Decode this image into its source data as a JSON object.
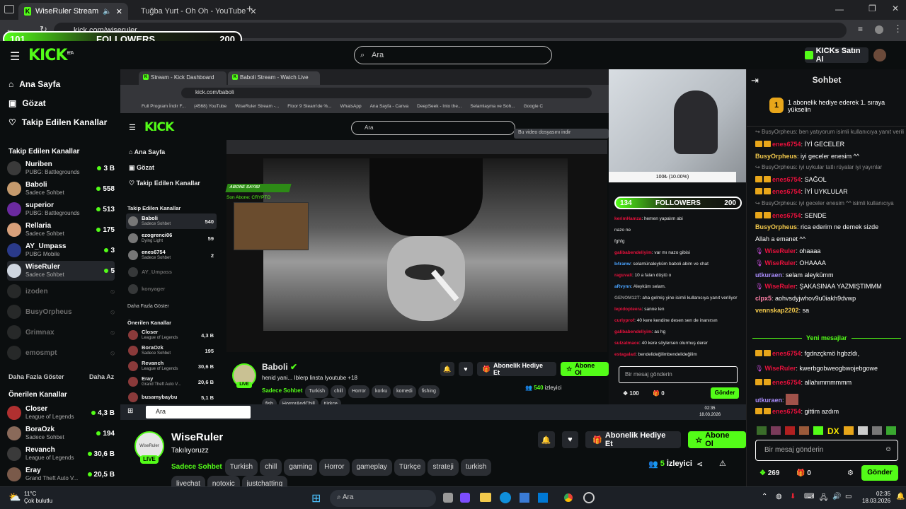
{
  "browser": {
    "tabs": [
      {
        "label": "WiseRuler Stream - Watch L",
        "active": true
      },
      {
        "label": "Tuğba Yurt - Oh Oh - YouTube",
        "active": false
      }
    ],
    "url": "kick.com/wiseruler"
  },
  "followers_overlay": {
    "current": "101",
    "label": "FOLLOWERS",
    "goal": "200"
  },
  "header": {
    "logo": "KICK",
    "logo_sup": "BETA",
    "search_placeholder": "Ara",
    "buy_kicks": "KICKs Satın Al"
  },
  "sidebar": {
    "nav": [
      {
        "label": "Ana Sayfa",
        "icon": "home-icon"
      },
      {
        "label": "Gözat",
        "icon": "browse-icon"
      },
      {
        "label": "Takip Edilen Kanallar",
        "icon": "heart-icon"
      }
    ],
    "followed_title": "Takip Edilen Kanallar",
    "followed": [
      {
        "name": "Nuriben",
        "category": "PUBG: Battlegrounds",
        "viewers": "3 B",
        "live": true
      },
      {
        "name": "Baboli",
        "category": "Sadece Sohbet",
        "viewers": "558",
        "live": true
      },
      {
        "name": "superior",
        "category": "PUBG: Battlegrounds",
        "viewers": "513",
        "live": true
      },
      {
        "name": "Rellaria",
        "category": "Sadece Sohbet",
        "viewers": "175",
        "live": true
      },
      {
        "name": "AY_Umpass",
        "category": "PUBG Mobile",
        "viewers": "3",
        "live": true
      },
      {
        "name": "WiseRuler",
        "category": "Sadece Sohbet",
        "viewers": "5",
        "live": true
      },
      {
        "name": "izoden",
        "category": "",
        "viewers": "",
        "live": false
      },
      {
        "name": "BusyOrpheus",
        "category": "",
        "viewers": "",
        "live": false
      },
      {
        "name": "Grimnax",
        "category": "",
        "viewers": "",
        "live": false
      },
      {
        "name": "emosmpt",
        "category": "",
        "viewers": "",
        "live": false
      }
    ],
    "show_more": "Daha Fazla Göster",
    "show_less": "Daha Az",
    "recommended_title": "Önerilen Kanallar",
    "recommended": [
      {
        "name": "Closer",
        "category": "League of Legends",
        "viewers": "4,3 B"
      },
      {
        "name": "BoraOzk",
        "category": "Sadece Sohbet",
        "viewers": "194"
      },
      {
        "name": "Revanch",
        "category": "League of Legends",
        "viewers": "30,6 B"
      },
      {
        "name": "Eray",
        "category": "Grand Theft Auto V...",
        "viewers": "20,5 B"
      }
    ]
  },
  "inner_stream": {
    "tabs": [
      "Stream - Kick Dashboard",
      "Baboli Stream - Watch Live"
    ],
    "url": "kick.com/baboli",
    "bookmarks": [
      "Full Program İndir F...",
      "(4568) YouTube",
      "WiseRuler Stream -...",
      "Floor 9 Steam'de %...",
      "WhatsApp",
      "Ana Sayfa - Canva",
      "DeepSeek - Into the...",
      "Selamlaşma ve Soh...",
      "Google C"
    ],
    "search_placeholder": "Ara",
    "download_hint": "Bu video dosyasını indir",
    "nav": [
      "Ana Sayfa",
      "Gözat",
      "Takip Edilen Kanallar"
    ],
    "followed_title": "Takip Edilen Kanallar",
    "followed": [
      {
        "name": "Baboli",
        "category": "Sadece Sohbet",
        "viewers": "540"
      },
      {
        "name": "ezogrenci06",
        "category": "Dying Light",
        "viewers": "59"
      },
      {
        "name": "enes6754",
        "category": "Sadece Sohbet",
        "viewers": "2"
      },
      {
        "name": "AY_Umpass",
        "category": "",
        "viewers": ""
      },
      {
        "name": "konyager",
        "category": "",
        "viewers": ""
      }
    ],
    "show_more": "Daha Fazla Göster",
    "recommended_title": "Önerilen Kanallar",
    "recommended": [
      {
        "name": "Closer",
        "category": "League of Legends",
        "viewers": "4,3 B"
      },
      {
        "name": "BoraOzk",
        "category": "Sadece Sohbet",
        "viewers": "195"
      },
      {
        "name": "Revanch",
        "category": "League of Legends",
        "viewers": "30,6 B"
      },
      {
        "name": "Eray",
        "category": "Grand Theft Auto V...",
        "viewers": "20,6 B"
      },
      {
        "name": "busamybaybu",
        "category": "",
        "viewers": "5,1 B"
      }
    ],
    "streamer": {
      "name": "Baboli",
      "title": "henid yani... Iblerp linsta Iyoutube +18",
      "category": "Sadece Sohbet",
      "tags": [
        "Turkish",
        "chill",
        "Horror",
        "korku",
        "komedi",
        "fishing",
        "fish",
        "HorrorAndChill",
        "türkçe"
      ],
      "viewers": "540",
      "viewers_label": "izleyici",
      "gift_label": "Abonelik Hediye Et",
      "follow_label": "Abone Ol",
      "live": "LIVE"
    },
    "overlay": {
      "subscribers": "ABONE SAYISI",
      "follow": "Son Abone: CRYPTO"
    },
    "webcam_progress": "100₺ (10.00%)",
    "followers": {
      "current": "134",
      "label": "FOLLOWERS",
      "goal": "200"
    },
    "chat": [
      {
        "user": "kerimHamza",
        "text": "hemen yapalım abi"
      },
      {
        "user": "",
        "text": "nazo ne"
      },
      {
        "user": "",
        "text": "fghfg"
      },
      {
        "user": "galibabendeliyim",
        "text": "var mı nazo gibisi"
      },
      {
        "user": "b4ranw",
        "text": "selamünaleyküm baboli abim ve chat"
      },
      {
        "user": "raguvali",
        "text": "10 a falan düştü o"
      },
      {
        "user": "aRvynn",
        "text": "Aleyküm selam."
      },
      {
        "user": "GENOM12T",
        "text": "aha gelmiş yine isimli kullanıcıya yanıt veriliyor"
      },
      {
        "user": "lepidopteera",
        "text": "sanne len"
      },
      {
        "user": "curlyprof",
        "text": "40 kere kendine desen sen de inanırsın"
      },
      {
        "user": "galibabendeliyim",
        "text": "as hg"
      },
      {
        "user": "sulzatmace",
        "text": "40 kere söylersen olurmuş derer"
      },
      {
        "user": "estagalad",
        "text": "bendelideğilimbendelideğilim"
      }
    ],
    "chat_placeholder": "Bir mesaj gönderin",
    "kicks": "100",
    "gifts": "0",
    "send": "Gönder",
    "taskbar_search": "Ara",
    "time": "02:35",
    "date": "18.03.2026"
  },
  "stream": {
    "streamer": "WiseRuler",
    "avatar_text": "WiseRuler",
    "title": "Takılıyoruzz",
    "category": "Sadece Sohbet",
    "tags": [
      "Turkish",
      "chill",
      "gaming",
      "Horror",
      "gameplay",
      "Türkçe",
      "strateji",
      "turkish",
      "livechat",
      "notoxic",
      "justchatting"
    ],
    "live": "LIVE",
    "viewers": "5",
    "viewers_label": "İzleyici",
    "gift_label": "Abonelik Hediye Et",
    "follow_label": "Abone Ol"
  },
  "chat": {
    "title": "Sohbet",
    "pinned": "1 abonelik hediye ederek 1. sıraya yükselin",
    "pinned_rank": "1",
    "messages": [
      {
        "reply": "BusyOrpheus: ben yatıyorum isimli kullanıcıya yanıt veriliyor",
        "user": "",
        "text": "",
        "color": "#8d8d8d"
      },
      {
        "user": "enes6754",
        "text": "İYİ GECELER",
        "color": "#e9113c",
        "badges": true
      },
      {
        "user": "BusyOrpheus",
        "text": "iyi geceler enesim ^^",
        "color": "#f2c94c"
      },
      {
        "reply": "BusyOrpheus: iyi uykular tatlı rüyalar iyi yayınlar",
        "user": "",
        "text": "",
        "color": "#8d8d8d"
      },
      {
        "user": "enes6754",
        "text": "SAĞOL",
        "color": "#e9113c",
        "badges": true
      },
      {
        "user": "enes6754",
        "text": "İYİ UYKLULAR",
        "color": "#e9113c",
        "badges": true
      },
      {
        "reply": "BusyOrpheus: iyi geceler enesim ^^ isimli kullanıcıya",
        "user": "",
        "text": "",
        "color": "#8d8d8d"
      },
      {
        "user": "enes6754",
        "text": "SENDE",
        "color": "#e9113c",
        "badges": true
      },
      {
        "user": "BusyOrpheus",
        "text": "rica ederim ne demek sizde",
        "color": "#f2c94c"
      },
      {
        "user": "",
        "text": "Allah a emanet ^^",
        "color": "#ffffff"
      },
      {
        "user": "WiseRuler",
        "text": "ohaaaa",
        "color": "#e9113c",
        "mic": true
      },
      {
        "user": "WiseRuler",
        "text": "OHAAAA",
        "color": "#e9113c",
        "mic": true
      },
      {
        "user": "utkuraen",
        "text": "selam aleykümm",
        "color": "#a88bfa"
      },
      {
        "user": "WiseRuler",
        "text": "ŞAKASINAA YAZMIŞTIMMM",
        "color": "#e9113c",
        "mic": true
      },
      {
        "user": "clpx5",
        "text": "aohvsdyjwhov9u0iakh9dvwp",
        "color": "#ff80a6"
      },
      {
        "user": "vennskap2202",
        "text": "sa",
        "color": "#f2c94c"
      }
    ],
    "new_messages": "Yeni mesajlar",
    "new": [
      {
        "user": "enes6754",
        "text": "fgdnzçkmö hgbzldı,",
        "color": "#e9113c",
        "badges": true
      },
      {
        "user": "WiseRuler",
        "text": "kwerbgobweogbwojebgowe",
        "color": "#e9113c",
        "mic": true
      },
      {
        "user": "enes6754",
        "text": "allahımmmmmm",
        "color": "#e9113c",
        "badges": true
      },
      {
        "user": "utkuraen",
        "text": "",
        "color": "#a88bfa",
        "emote": true
      },
      {
        "user": "enes6754",
        "text": "gittim azdım",
        "color": "#e9113c",
        "badges": true
      }
    ],
    "input_placeholder": "Bir mesaj gönderin",
    "kicks": "269",
    "gifts": "0",
    "send": "Gönder"
  },
  "taskbar": {
    "weather_temp": "11°C",
    "weather_desc": "Çok bulutlu",
    "search": "Ara",
    "time": "02:35",
    "date": "18.03.2026"
  }
}
